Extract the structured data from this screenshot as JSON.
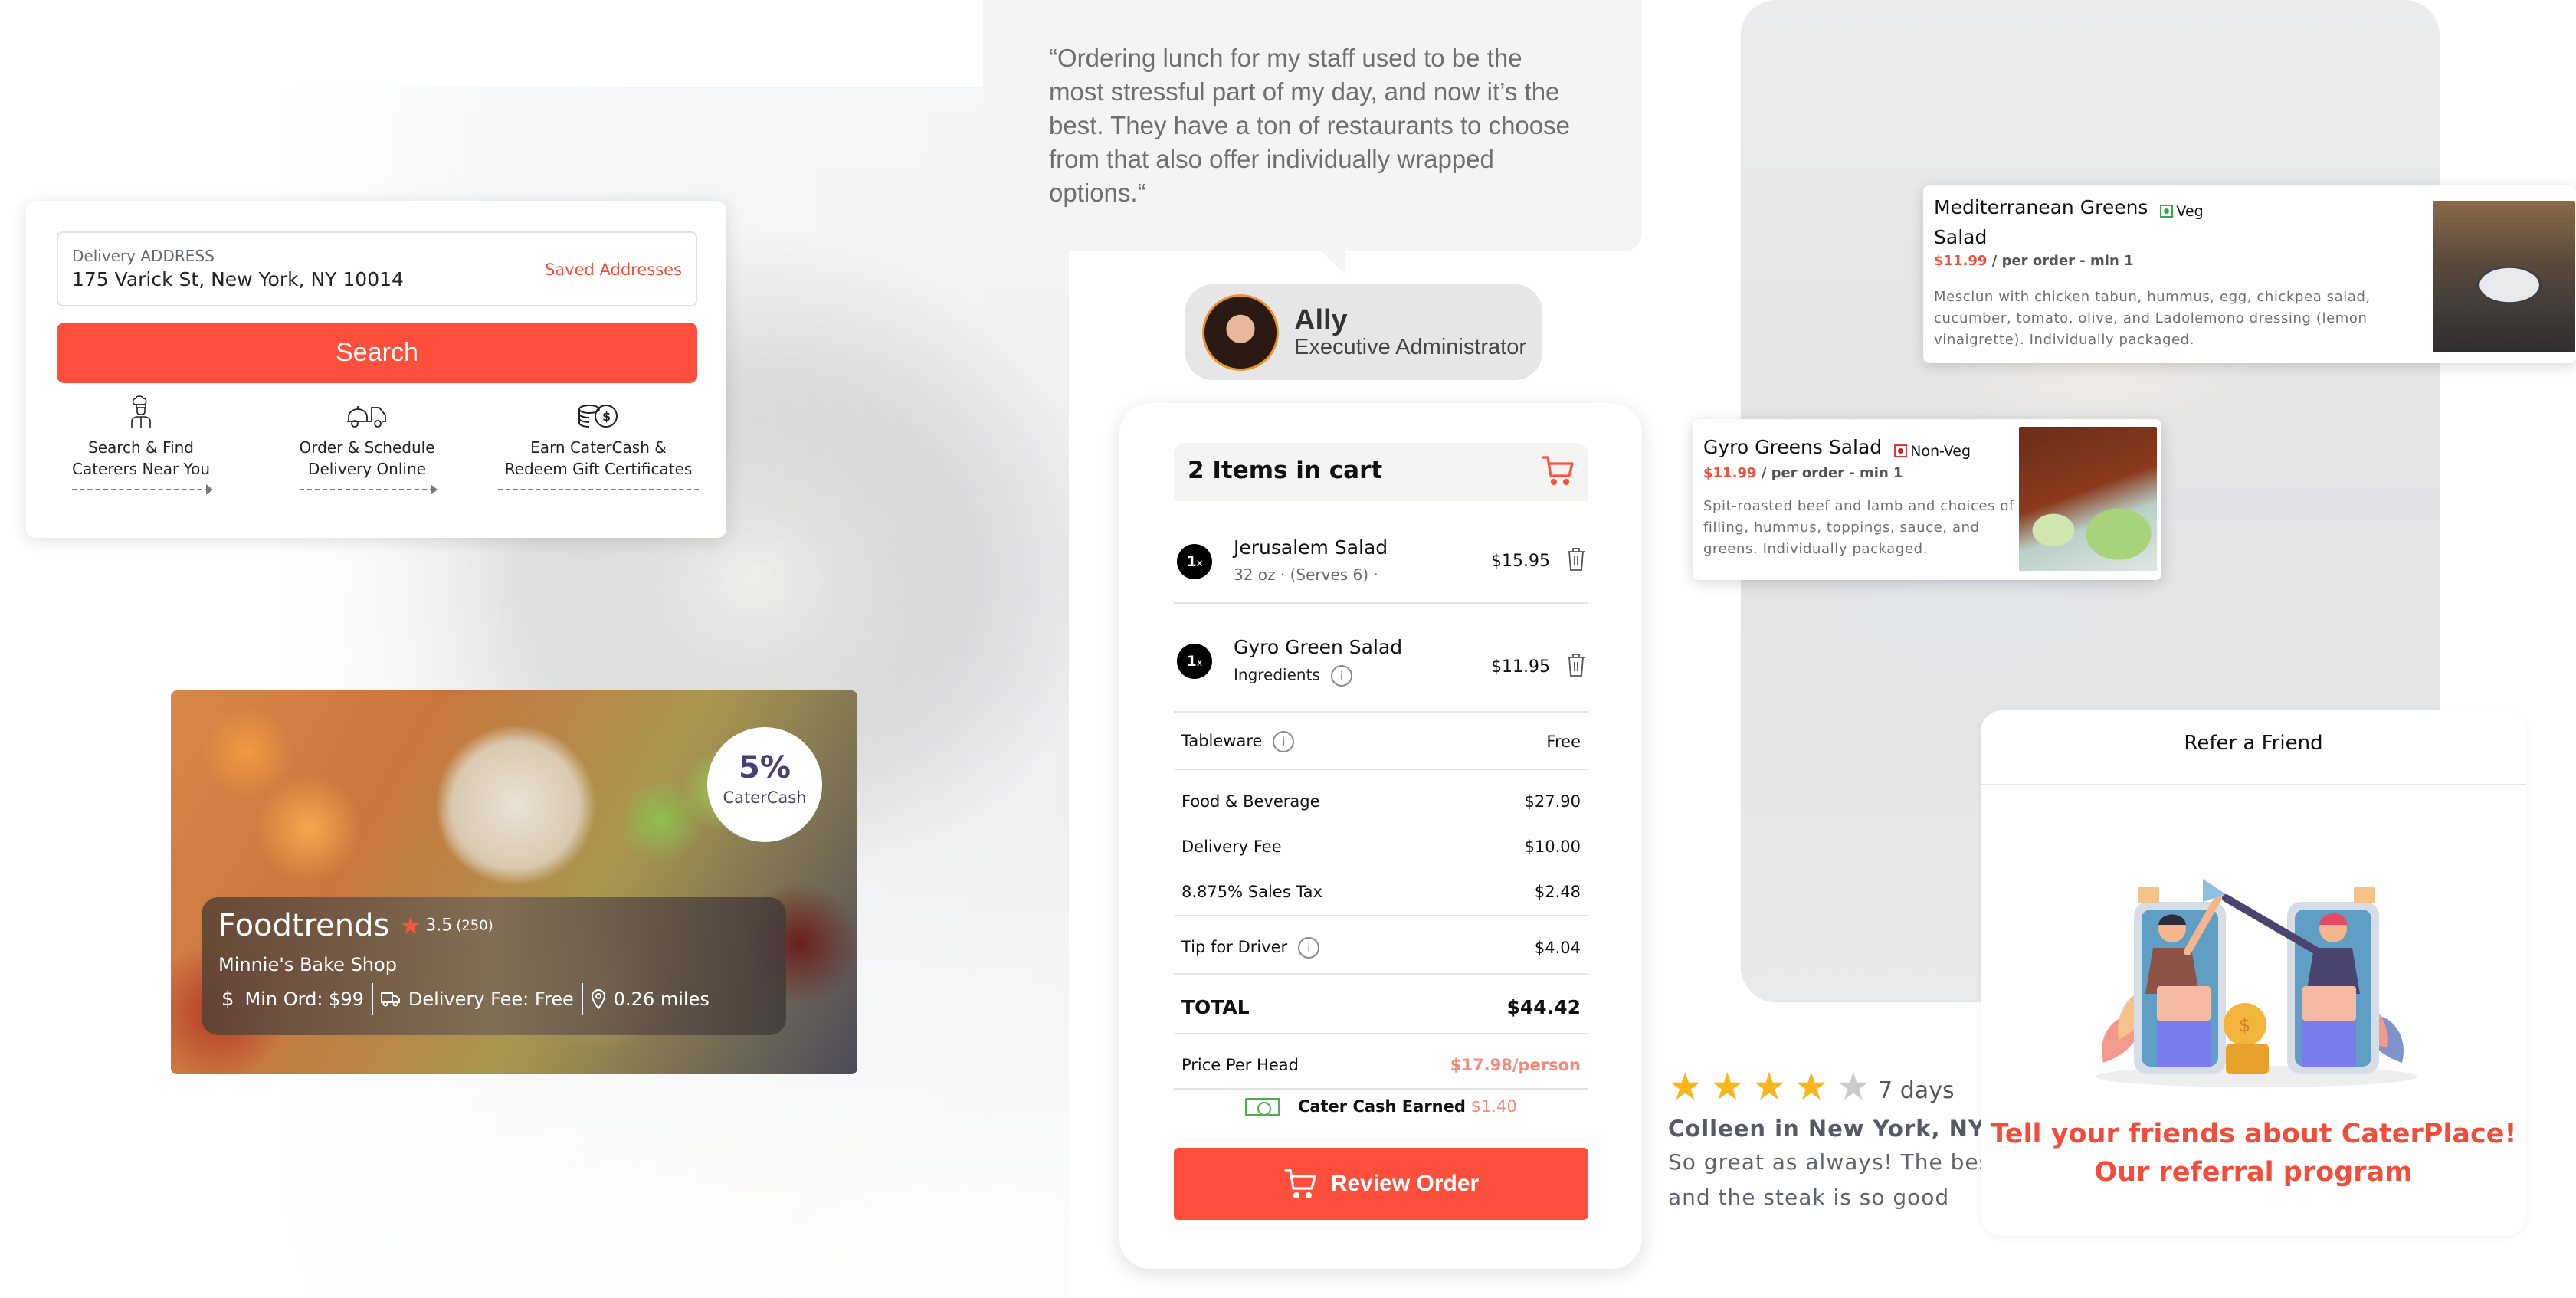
{
  "search_card": {
    "address_label": "Delivery ADDRESS",
    "address_value": "175 Varick St, New York, NY 10014",
    "saved_addresses_link": "Saved Addresses",
    "search_button": "Search",
    "features": [
      {
        "icon": "chef-icon",
        "line1": "Search & Find",
        "line2": "Caterers Near You"
      },
      {
        "icon": "delivery-truck-icon",
        "line1": "Order & Schedule",
        "line2": "Delivery Online"
      },
      {
        "icon": "coins-icon",
        "line1": "Earn CaterCash &",
        "line2": "Redeem Gift Certificates"
      }
    ]
  },
  "restaurant_card": {
    "catercash_percent": "5%",
    "catercash_label": "CaterCash",
    "name": "Foodtrends",
    "rating": "3.5",
    "rating_count": "(250)",
    "subtitle": "Minnie's Bake Shop",
    "min_order": "Min Ord: $99",
    "delivery_fee": "Delivery Fee: Free",
    "distance": "0.26 miles"
  },
  "testimonial": {
    "quote": "“Ordering lunch for my staff used to be the most stressful part of my day, and now it’s the best. They have a ton of restaurants to choose from that also offer individually wrapped options.“",
    "name": "Ally",
    "role": "Executive Administrator"
  },
  "cart": {
    "title": "2 Items in cart",
    "items": [
      {
        "qty": "1",
        "qty_suffix": "x",
        "name": "Jerusalem Salad",
        "sub": "32 oz  ·  (Serves 6)  ·",
        "price": "$15.95"
      },
      {
        "qty": "1",
        "qty_suffix": "x",
        "name": "Gyro Green Salad",
        "sub": "Ingredients",
        "price": "$11.95"
      }
    ],
    "tableware": {
      "label": "Tableware",
      "value": "Free"
    },
    "food_beverage": {
      "label": "Food & Beverage",
      "value": "$27.90"
    },
    "delivery_fee": {
      "label": "Delivery Fee",
      "value": "$10.00"
    },
    "sales_tax": {
      "label": "8.875% Sales Tax",
      "value": "$2.48"
    },
    "tip": {
      "label": "Tip for Driver",
      "value": "$4.04"
    },
    "total": {
      "label": "TOTAL",
      "value": "$44.42"
    },
    "price_per_head": {
      "label": "Price Per Head",
      "value": "$17.98/person"
    },
    "cater_cash": {
      "label": "Cater Cash Earned",
      "value": "$1.40"
    },
    "review_button": "Review Order"
  },
  "dishes": [
    {
      "name_line1": "Mediterranean Greens",
      "name_line2": "Salad",
      "tag": "Veg",
      "price": "$11.99",
      "price_suffix": " / per order - min 1",
      "description": "Mesclun with chicken tabun, hummus, egg, chickpea salad, cucumber, tomato, olive, and Ladolemono dressing (lemon vinaigrette). Individually packaged."
    },
    {
      "name_line1": "Gyro Greens Salad",
      "tag": "Non-Veg",
      "price": "$11.99",
      "price_suffix": " / per order - min 1",
      "description": "Spit-roasted beef and lamb and choices of filling, hummus, toppings, sauce, and greens. Individually packaged."
    }
  ],
  "review": {
    "rating": 4,
    "max_rating": 5,
    "age": "7 days",
    "reviewer": "Colleen in New York, NY",
    "text": "So great as always! The best and the steak is so good"
  },
  "refer": {
    "title": "Refer a Friend",
    "cta_line1": "Tell your friends about CaterPlace!",
    "cta_line2": "Our referral program"
  },
  "colors": {
    "brand_red": "#fd4f3b",
    "price_pink": "#f58a7a",
    "star_gold": "#f9b51c",
    "catercash_purple": "#4b3f72",
    "veg_green": "#37a94a"
  }
}
